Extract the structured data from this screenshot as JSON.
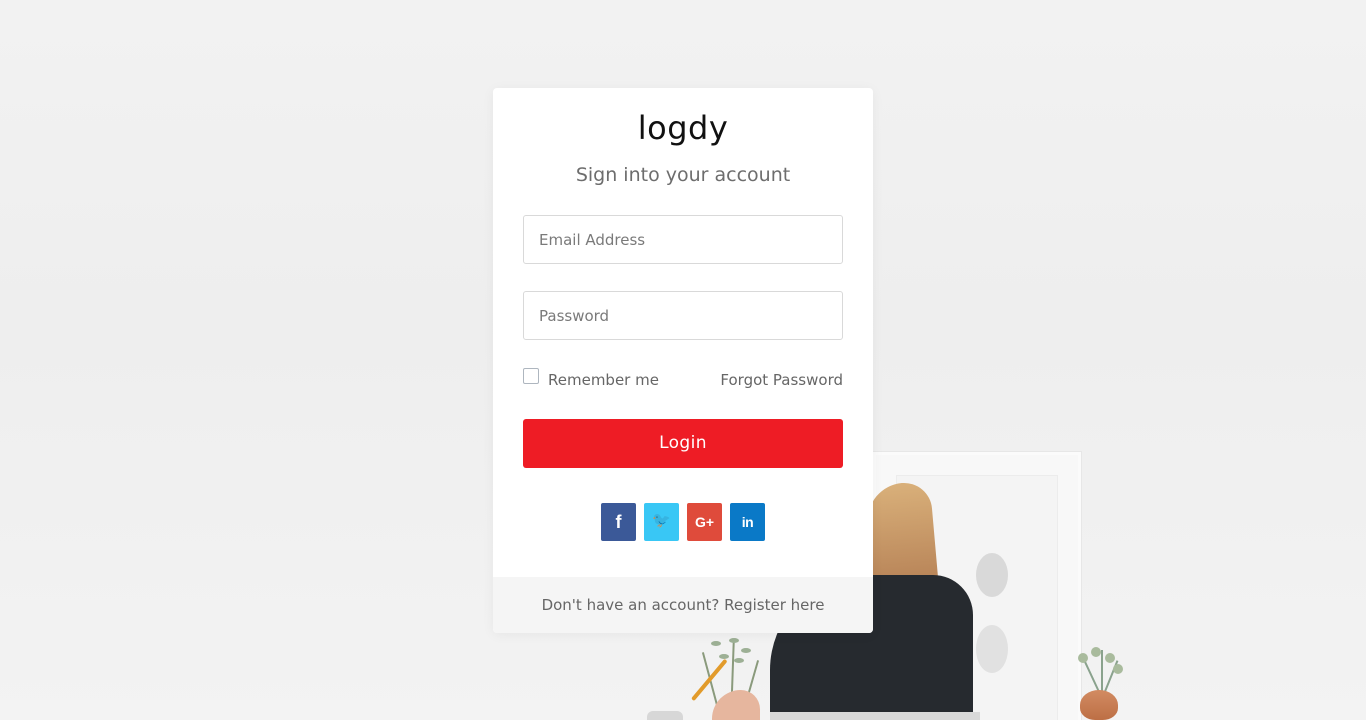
{
  "brand": {
    "logo_text": "logdy"
  },
  "auth": {
    "subtitle": "Sign into your account",
    "email": {
      "placeholder": "Email Address",
      "value": ""
    },
    "password": {
      "placeholder": "Password",
      "value": ""
    },
    "remember_label": "Remember me",
    "forgot_label": "Forgot Password",
    "login_label": "Login",
    "footer_prefix": "Don't have an account?",
    "footer_link": "Register here"
  },
  "social": {
    "facebook_icon": "facebook-icon",
    "twitter_icon": "twitter-icon",
    "google_icon": "google-plus-icon",
    "linkedin_icon": "linkedin-icon"
  },
  "colors": {
    "login_button": "#ee1c25",
    "facebook": "#3b5998",
    "twitter": "#39c7f5",
    "google_plus": "#df4b3b",
    "linkedin": "#0a79c7"
  }
}
